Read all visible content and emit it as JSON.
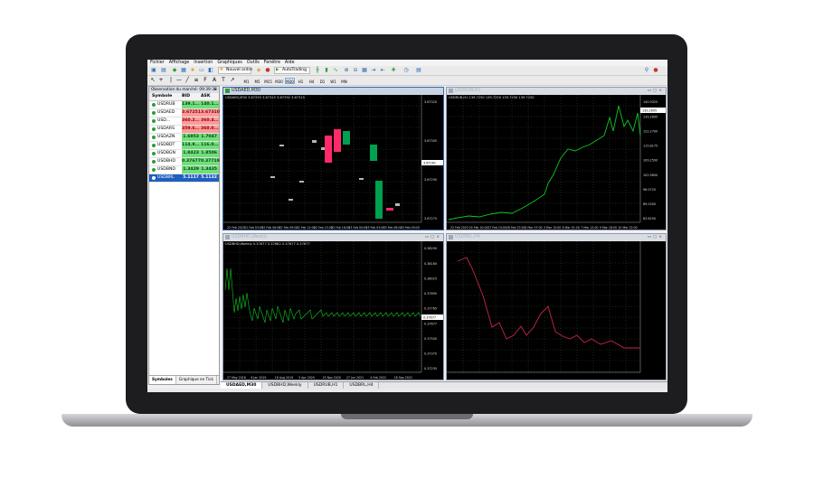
{
  "menu": [
    "Fichier",
    "Affichage",
    "Insertion",
    "Graphiques",
    "Outils",
    "Fenêtre",
    "Aide"
  ],
  "toolbar": {
    "new_order": "Nouvel ordre",
    "auto_trading": "AutoTrading",
    "timeframes": [
      "M1",
      "M5",
      "M15",
      "M30",
      "H1",
      "H4",
      "D1",
      "W1",
      "MN"
    ],
    "active_timeframe": "M30"
  },
  "market_watch": {
    "title": "Observation du marché: 09:39:38",
    "close": "×",
    "col_symbol": "Symbole",
    "col_bid": "BID",
    "col_ask": "ASK",
    "rows": [
      {
        "symbol": "USDRUB",
        "bid": "139.1...",
        "ask": "140.1...",
        "trend": "up"
      },
      {
        "symbol": "USDAED",
        "bid": "3.67251",
        "ask": "3.67310",
        "trend": "dn"
      },
      {
        "symbol": "USD...",
        "bid": "360.2...",
        "ask": "360.4...",
        "trend": "dn"
      },
      {
        "symbol": "USDARS",
        "bid": "359.6...",
        "ask": "360.0...",
        "trend": "dn"
      },
      {
        "symbol": "USDAZN",
        "bid": "1.6953",
        "ask": "1.7047",
        "trend": "up"
      },
      {
        "symbol": "USDBDT",
        "bid": "114.9...",
        "ask": "116.0...",
        "trend": "up"
      },
      {
        "symbol": "USDBGN",
        "bid": "1.8423",
        "ask": "1.8506",
        "trend": "up"
      },
      {
        "symbol": "USDBHD",
        "bid": "0.37677",
        "ask": "0.37719",
        "trend": "up"
      },
      {
        "symbol": "USDBND",
        "bid": "1.3429",
        "ask": "1.3435",
        "trend": "up"
      },
      {
        "symbol": "USDBRL",
        "bid": "5.1117",
        "ask": "5.1132",
        "trend": "sel"
      }
    ],
    "tabs": [
      "Symboles",
      "Graphique en Tick"
    ]
  },
  "charts": [
    {
      "title": "USDAED,M30",
      "info": "USDAED,M30  3.67293 3.67315 3.67292 3.67315",
      "prices": [
        "3.67320",
        "3.67305",
        "3.67290",
        "3.67275"
      ],
      "current": "3.67281",
      "dates": [
        "22 Feb 2023",
        "22 Feb 03:00",
        "22 Feb 06:00",
        "22 Feb 09:00",
        "22 Feb 12:00",
        "22 Feb 15:00",
        "22 Feb 18:00",
        "23 Feb 00:00",
        "23 Feb 03:00",
        "23 Feb 06:00",
        "23 Feb 09:00"
      ]
    },
    {
      "title": "USDRUB,H1",
      "info": "USDRUB,H1  139.7250 139.7250 139.7250 139.7250",
      "prices": [
        "140.9325",
        "139.2695",
        "122.2700",
        "115.8175",
        "109.2500",
        "102.9850",
        "96.0725",
        "89.0300",
        "83.6250"
      ],
      "current": "139.2695",
      "dates": [
        "22 Feb 2023",
        "24 Feb 10:00",
        "27 Feb 15:00",
        "28 Feb 23:00",
        "2 Mar 07:00",
        "3 Mar 15:00",
        "6 Mar 01:00",
        "7 Mar 12:00",
        "9 Mar 18:00",
        "10 Mar 22:00"
      ]
    },
    {
      "title": "USDBHD,Weekly",
      "info": "USDBHD,Weekly  0.37677 0.37682 0.37677 0.37677",
      "prices": [
        "0.38290",
        "0.38160",
        "0.38025",
        "0.37895",
        "0.37765",
        "0.37677",
        "0.37500",
        "0.37370",
        "0.37235"
      ],
      "current": "0.37677",
      "dates": [
        "27 May 2018",
        "6 Jan 2019",
        "18 Aug 2019",
        "5 Apr 2020",
        "15 Nov 2020",
        "27 Jun 2021",
        "4 Feb 2022",
        "18 Sep 2022"
      ]
    },
    {
      "title": "USDBRL,H4",
      "info": "",
      "prices": [],
      "current": "",
      "dates": []
    }
  ],
  "bottom_tabs": [
    "USDAED,M30",
    "USDBHD,Weekly",
    "USDRUB,H1",
    "USDBRL,H4"
  ],
  "colors": {
    "bull": "#00a050",
    "bear": "#ff2a6a",
    "line_green": "#12c622",
    "line_red": "#c8264a",
    "grid": "#3a5f3a"
  }
}
